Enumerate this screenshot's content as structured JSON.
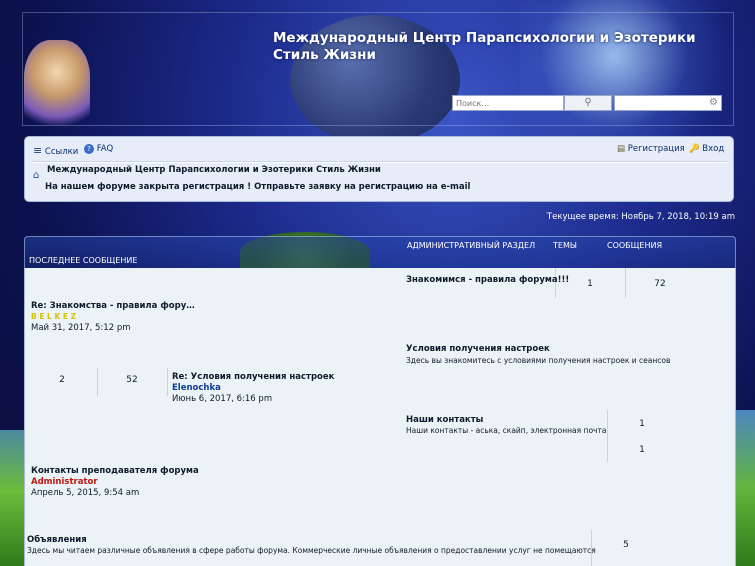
{
  "header": {
    "title": "Международный Центр Парапсихологии и Эзотерики Стиль Жизни",
    "search_placeholder": "Поиск…"
  },
  "nav": {
    "links_label": "Ссылки",
    "faq_label": "FAQ",
    "register_label": "Регистрация",
    "login_label": "Вход",
    "breadcrumb": "Международный Центр Парапсихологии и Эзотерики Стиль Жизни",
    "announcement": "На нашем форуме закрыта регистрация ! Отправьте заявку на регистрацию на e-mail"
  },
  "current_time": "Текущее время: Ноябрь 7, 2018, 10:19 am",
  "forum_head": {
    "section": "Административный раздел",
    "topics": "Темы",
    "posts": "Сообщения",
    "last_post": "Последнее сообщение"
  },
  "forums": [
    {
      "title": "Знакомимся - правила форума!!!",
      "desc": "",
      "topics": "1",
      "posts": "72",
      "last_title": "Re: Знакомства - правила фору…",
      "last_user": "B E L K E Z",
      "last_date": "Май 31, 2017, 5:12 pm"
    },
    {
      "title": "Условия получения настроек",
      "desc": "Здесь вы знакомитесь с условиями получения настроек и сеансов",
      "topics": "2",
      "posts": "52",
      "last_title": "Re: Условия получения настроек",
      "last_user": "Elenochka",
      "last_date": "Июнь 6, 2017, 6:16 pm"
    },
    {
      "title": "Наши контакты",
      "desc": "Наши контакты - аська, скайп, электронная почта",
      "topics": "1",
      "posts": "1",
      "last_title": "Контакты преподавателя форума",
      "last_user": "Administrator",
      "last_date": "Апрель 5, 2015, 9:54 am"
    },
    {
      "title": "Объявления",
      "desc": "Здесь мы читаем различные объявления в сфере работы форума. Коммерческие личные объявления о предоставлении услуг не помещаются",
      "topics": "5"
    }
  ]
}
